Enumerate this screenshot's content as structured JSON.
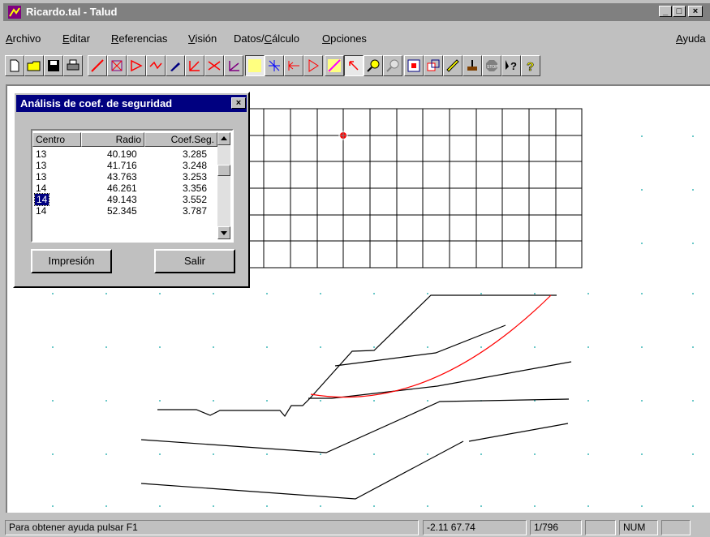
{
  "window": {
    "title": "Ricardo.tal - Talud",
    "minimize": "_",
    "maximize": "□",
    "close": "×"
  },
  "menu": [
    {
      "u": "A",
      "rest": "rchivo"
    },
    {
      "u": "E",
      "rest": "ditar"
    },
    {
      "u": "R",
      "rest": "eferencias"
    },
    {
      "u": "V",
      "rest": "isión"
    },
    {
      "pre": "Datos/",
      "u": "C",
      "rest": "álculo"
    },
    {
      "u": "O",
      "rest": "pciones"
    }
  ],
  "menu_right": {
    "u": "A",
    "rest": "yuda"
  },
  "toolbar_icons": [
    "new-icon",
    "open-icon",
    "save-icon",
    "print-icon",
    "line-icon",
    "node-icon",
    "polygon-icon",
    "move-icon",
    "pencil-icon",
    "corner-icon",
    "cross-icon",
    "arrow-icon",
    "grid-icon",
    "crosshair-icon",
    "left-arrow-icon",
    "right-arrow-icon",
    "diag-icon",
    "pointer-icon",
    "zoom-in-icon",
    "zoom-out-icon",
    "frame-icon",
    "window-icon",
    "ruler-icon",
    "brush-icon",
    "stop-icon",
    "help-pointer-icon",
    "question-icon"
  ],
  "dialog": {
    "title": "Análisis de coef. de seguridad",
    "close": "×",
    "columns": [
      "Centro",
      "Radio",
      "Coef.Seg."
    ],
    "rows": [
      {
        "centro": "13",
        "radio": "40.190",
        "coef": "3.285"
      },
      {
        "centro": "13",
        "radio": "41.716",
        "coef": "3.248"
      },
      {
        "centro": "13",
        "radio": "43.763",
        "coef": "3.253"
      },
      {
        "centro": "14",
        "radio": "46.261",
        "coef": "3.356"
      },
      {
        "centro": "14",
        "radio": "49.143",
        "coef": "3.552"
      },
      {
        "centro": "14",
        "radio": "52.345",
        "coef": "3.787"
      }
    ],
    "selected_row": 4,
    "print_button": "Impresión",
    "exit_button": "Salir"
  },
  "status": {
    "help": "Para obtener ayuda pulsar F1",
    "coords": "-2.11  67.74",
    "count": "1/796",
    "empty": "",
    "num": "NUM"
  },
  "colors": {
    "title_inactive": "#808080",
    "dialog_title": "#000080",
    "failure_circle": "#ff0000"
  }
}
